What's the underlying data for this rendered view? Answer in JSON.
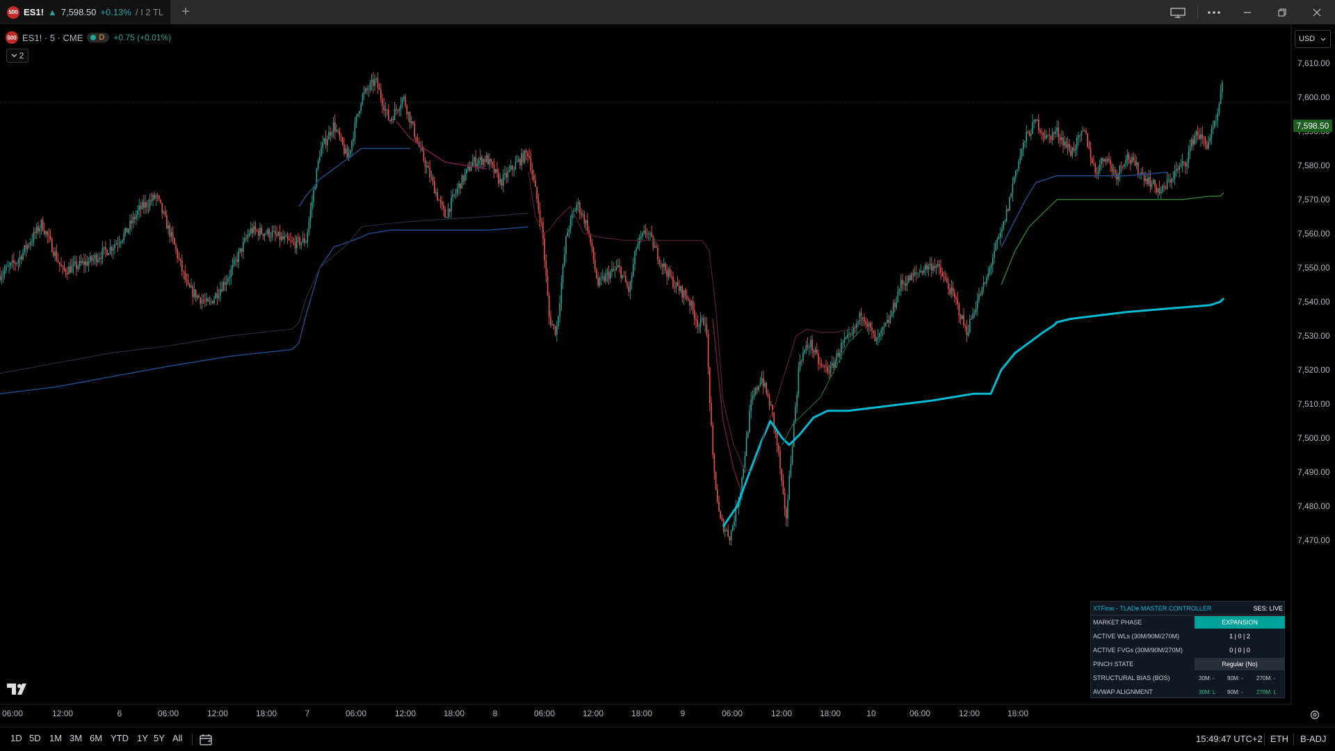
{
  "tab": {
    "badge": "500",
    "symbol": "ES1!",
    "arrow": "▲",
    "price": "7,598.50",
    "change": "+0.13%",
    "tail": "/ I 2 TL"
  },
  "legend": {
    "badge": "500",
    "symbol": "ES1! · 5 · CME",
    "pill_letter": "D",
    "change": "+0.75 (+0.01%)",
    "collapse_count": "2"
  },
  "currency": "USD",
  "last_price_tag": "7,598.50",
  "y_axis": {
    "ticks": [
      "7,610.00",
      "7,600.00",
      "7,590.00",
      "7,580.00",
      "7,570.00",
      "7,560.00",
      "7,550.00",
      "7,540.00",
      "7,530.00",
      "7,520.00",
      "7,510.00",
      "7,500.00",
      "7,490.00",
      "7,480.00",
      "7,470.00"
    ]
  },
  "x_axis": {
    "ticks": [
      "06:00",
      "12:00",
      "6",
      "06:00",
      "12:00",
      "18:00",
      "7",
      "06:00",
      "12:00",
      "18:00",
      "8",
      "06:00",
      "12:00",
      "18:00",
      "9",
      "06:00",
      "12:00",
      "18:00",
      "10",
      "06:00",
      "12:00",
      "18:00"
    ]
  },
  "chart_data": {
    "type": "line",
    "title": "",
    "ylim": [
      7465,
      7618
    ],
    "price_path": [
      [
        0,
        7548
      ],
      [
        25,
        7552
      ],
      [
        60,
        7563
      ],
      [
        90,
        7549
      ],
      [
        130,
        7552
      ],
      [
        160,
        7556
      ],
      [
        180,
        7560
      ],
      [
        200,
        7567
      ],
      [
        225,
        7571
      ],
      [
        250,
        7557
      ],
      [
        270,
        7544
      ],
      [
        300,
        7539
      ],
      [
        330,
        7548
      ],
      [
        360,
        7561
      ],
      [
        390,
        7560
      ],
      [
        420,
        7557
      ],
      [
        440,
        7558
      ],
      [
        460,
        7584
      ],
      [
        480,
        7592
      ],
      [
        500,
        7582
      ],
      [
        520,
        7600
      ],
      [
        540,
        7605
      ],
      [
        560,
        7593
      ],
      [
        580,
        7600
      ],
      [
        600,
        7587
      ],
      [
        620,
        7576
      ],
      [
        640,
        7565
      ],
      [
        660,
        7574
      ],
      [
        680,
        7581
      ],
      [
        700,
        7582
      ],
      [
        720,
        7575
      ],
      [
        740,
        7580
      ],
      [
        760,
        7584
      ],
      [
        780,
        7561
      ],
      [
        790,
        7535
      ],
      [
        800,
        7531
      ],
      [
        815,
        7560
      ],
      [
        830,
        7569
      ],
      [
        845,
        7562
      ],
      [
        860,
        7545
      ],
      [
        875,
        7548
      ],
      [
        890,
        7550
      ],
      [
        905,
        7543
      ],
      [
        915,
        7556
      ],
      [
        930,
        7561
      ],
      [
        950,
        7552
      ],
      [
        970,
        7545
      ],
      [
        990,
        7541
      ],
      [
        1005,
        7533
      ],
      [
        1015,
        7535
      ],
      [
        1025,
        7494
      ],
      [
        1035,
        7476
      ],
      [
        1050,
        7471
      ],
      [
        1065,
        7485
      ],
      [
        1080,
        7510
      ],
      [
        1095,
        7518
      ],
      [
        1110,
        7508
      ],
      [
        1120,
        7495
      ],
      [
        1130,
        7475
      ],
      [
        1140,
        7500
      ],
      [
        1150,
        7523
      ],
      [
        1165,
        7528
      ],
      [
        1180,
        7521
      ],
      [
        1195,
        7520
      ],
      [
        1210,
        7527
      ],
      [
        1225,
        7530
      ],
      [
        1240,
        7537
      ],
      [
        1260,
        7528
      ],
      [
        1280,
        7535
      ],
      [
        1295,
        7545
      ],
      [
        1310,
        7547
      ],
      [
        1330,
        7550
      ],
      [
        1345,
        7551
      ],
      [
        1360,
        7546
      ],
      [
        1375,
        7540
      ],
      [
        1390,
        7531
      ],
      [
        1405,
        7540
      ],
      [
        1420,
        7547
      ],
      [
        1430,
        7555
      ],
      [
        1440,
        7560
      ],
      [
        1450,
        7568
      ],
      [
        1460,
        7578
      ],
      [
        1475,
        7588
      ],
      [
        1490,
        7593
      ],
      [
        1505,
        7588
      ],
      [
        1520,
        7590
      ],
      [
        1540,
        7584
      ],
      [
        1560,
        7590
      ],
      [
        1575,
        7578
      ],
      [
        1590,
        7583
      ],
      [
        1605,
        7577
      ],
      [
        1620,
        7583
      ],
      [
        1640,
        7578
      ],
      [
        1655,
        7575
      ],
      [
        1670,
        7572
      ],
      [
        1690,
        7578
      ],
      [
        1705,
        7581
      ],
      [
        1720,
        7590
      ],
      [
        1735,
        7586
      ],
      [
        1750,
        7593
      ],
      [
        1760,
        7606
      ]
    ],
    "lines": [
      {
        "color": "#00bcd4",
        "width": 3,
        "points": [
          [
            1040,
            7474
          ],
          [
            1060,
            7480
          ],
          [
            1080,
            7491
          ],
          [
            1095,
            7499
          ],
          [
            1108,
            7505
          ],
          [
            1125,
            7500
          ],
          [
            1135,
            7498
          ],
          [
            1150,
            7501
          ],
          [
            1170,
            7506
          ],
          [
            1190,
            7508
          ],
          [
            1220,
            7508
          ],
          [
            1260,
            7509
          ],
          [
            1300,
            7510
          ],
          [
            1340,
            7511
          ],
          [
            1400,
            7513
          ],
          [
            1425,
            7513
          ],
          [
            1440,
            7520
          ],
          [
            1460,
            7525
          ],
          [
            1480,
            7528
          ],
          [
            1500,
            7531
          ],
          [
            1515,
            7533
          ],
          [
            1520,
            7534
          ],
          [
            1540,
            7535
          ],
          [
            1580,
            7536
          ],
          [
            1620,
            7537
          ],
          [
            1680,
            7538
          ],
          [
            1740,
            7539
          ],
          [
            1755,
            7540
          ],
          [
            1760,
            7541
          ]
        ]
      },
      {
        "color": "#1e4a8a",
        "width": 1.5,
        "points": [
          [
            0,
            7513
          ],
          [
            80,
            7515
          ],
          [
            160,
            7518
          ],
          [
            240,
            7521
          ],
          [
            330,
            7524
          ],
          [
            420,
            7526
          ],
          [
            430,
            7528
          ],
          [
            440,
            7536
          ],
          [
            460,
            7550
          ],
          [
            480,
            7556
          ],
          [
            520,
            7559
          ],
          [
            530,
            7560
          ],
          [
            560,
            7561
          ],
          [
            620,
            7561
          ],
          [
            700,
            7561
          ],
          [
            760,
            7562
          ]
        ]
      },
      {
        "color": "#2a2a3a",
        "width": 1.2,
        "points": [
          [
            0,
            7519
          ],
          [
            80,
            7522
          ],
          [
            160,
            7525
          ],
          [
            240,
            7527
          ],
          [
            330,
            7530
          ],
          [
            420,
            7532
          ],
          [
            430,
            7534
          ],
          [
            440,
            7541
          ],
          [
            460,
            7550
          ],
          [
            500,
            7557
          ],
          [
            520,
            7562
          ],
          [
            560,
            7563
          ],
          [
            620,
            7564
          ],
          [
            700,
            7565
          ],
          [
            760,
            7566
          ]
        ]
      },
      {
        "color": "#1e4a8a",
        "width": 1.5,
        "points": [
          [
            430,
            7568
          ],
          [
            440,
            7571
          ],
          [
            460,
            7576
          ],
          [
            480,
            7579
          ],
          [
            500,
            7582
          ],
          [
            520,
            7585
          ],
          [
            560,
            7585
          ],
          [
            590,
            7585
          ]
        ]
      },
      {
        "color": "#7a1f4a",
        "width": 1.5,
        "points": [
          [
            570,
            7593
          ],
          [
            590,
            7588
          ],
          [
            610,
            7585
          ],
          [
            640,
            7581
          ],
          [
            670,
            7580
          ],
          [
            700,
            7579
          ]
        ]
      },
      {
        "color": "#5a1f30",
        "width": 1.2,
        "points": [
          [
            760,
            7578
          ],
          [
            770,
            7565
          ],
          [
            780,
            7560
          ],
          [
            790,
            7561
          ],
          [
            800,
            7564
          ],
          [
            820,
            7568
          ],
          [
            840,
            7560
          ],
          [
            860,
            7559
          ],
          [
            900,
            7558
          ],
          [
            960,
            7558
          ],
          [
            1010,
            7558
          ],
          [
            1020,
            7555
          ],
          [
            1030,
            7537
          ],
          [
            1040,
            7511
          ],
          [
            1055,
            7498
          ],
          [
            1070,
            7491
          ],
          [
            1080,
            7490
          ],
          [
            1090,
            7494
          ],
          [
            1100,
            7502
          ],
          [
            1115,
            7510
          ],
          [
            1130,
            7520
          ],
          [
            1145,
            7530
          ],
          [
            1160,
            7532
          ],
          [
            1180,
            7531
          ],
          [
            1200,
            7531
          ],
          [
            1225,
            7532
          ],
          [
            1240,
            7536
          ]
        ]
      },
      {
        "color": "#6a1f3a",
        "width": 1.5,
        "points": [
          [
            1025,
            7535
          ],
          [
            1030,
            7525
          ],
          [
            1040,
            7505
          ],
          [
            1055,
            7491
          ],
          [
            1065,
            7485
          ]
        ]
      },
      {
        "color": "#1e6a3a",
        "width": 1.2,
        "points": [
          [
            1125,
            7498
          ],
          [
            1140,
            7504
          ],
          [
            1160,
            7508
          ],
          [
            1180,
            7512
          ],
          [
            1200,
            7520
          ],
          [
            1220,
            7528
          ],
          [
            1240,
            7532
          ]
        ]
      },
      {
        "color": "#1e4a8a",
        "width": 1.5,
        "points": [
          [
            1440,
            7556
          ],
          [
            1460,
            7564
          ],
          [
            1475,
            7570
          ],
          [
            1490,
            7575
          ],
          [
            1505,
            7576
          ],
          [
            1520,
            7577
          ],
          [
            1560,
            7577
          ],
          [
            1620,
            7577
          ],
          [
            1680,
            7578
          ]
        ]
      },
      {
        "color": "#2e7d32",
        "width": 1.5,
        "points": [
          [
            1440,
            7545
          ],
          [
            1460,
            7555
          ],
          [
            1480,
            7562
          ],
          [
            1500,
            7566
          ],
          [
            1515,
            7569
          ],
          [
            1520,
            7570
          ],
          [
            1560,
            7570
          ],
          [
            1620,
            7570
          ],
          [
            1700,
            7570
          ],
          [
            1740,
            7571
          ],
          [
            1755,
            7571
          ],
          [
            1760,
            7572
          ]
        ]
      }
    ]
  },
  "controller": {
    "title": "XTFlow - TLADe MASTER CONTROLLER",
    "ses": "SES: LIVE",
    "rows": [
      {
        "label": "MARKET PHASE",
        "value": "EXPANSION"
      },
      {
        "label": "ACTIVE WLs (30M/90M/270M)",
        "value": "1 | 0 | 2"
      },
      {
        "label": "ACTIVE FVGs (30M/90M/270M)",
        "value": "0 | 0 | 0"
      },
      {
        "label": "PINCH STATE",
        "value": "Regular (No)"
      },
      {
        "label": "STRUCTURAL BIAS (BOS)",
        "v1": "30M: -",
        "v2": "90M: -",
        "v3": "270M: -"
      },
      {
        "label": "AVWAP ALIGNMENT",
        "v1": "30M: L",
        "v2": "90M: -",
        "v3": "270M: L"
      }
    ],
    "colors": {
      "expansion": "#00a29a",
      "bias_text": "#c8ccd6",
      "avwap_text": "#26c281"
    }
  },
  "bottom": {
    "ranges": [
      "1D",
      "5D",
      "1M",
      "3M",
      "6M",
      "YTD",
      "1Y",
      "5Y",
      "All"
    ],
    "time": "15:49:47 UTC+2",
    "session": "ETH",
    "adj": "B-ADJ"
  },
  "icons": [
    "calendar-range-icon",
    "gear-icon",
    "tradingview-logo-icon",
    "layout-icon",
    "more-icon",
    "minimize-icon",
    "maximize-icon",
    "close-icon",
    "chevron-down-icon",
    "plus-icon"
  ]
}
